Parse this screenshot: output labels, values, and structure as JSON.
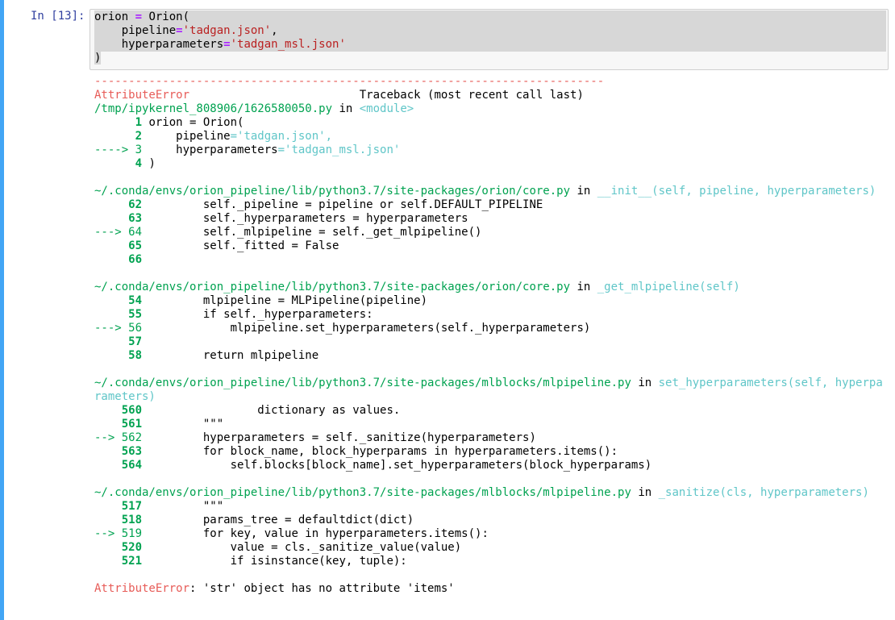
{
  "cell": {
    "prompt": "In [13]:",
    "code": {
      "l1_a": "orion ",
      "l1_eq": "=",
      "l1_b": " Orion(",
      "l2_a": "    pipeline",
      "l2_eq": "=",
      "l2_str": "'tadgan.json'",
      "l2_b": ",",
      "l3_a": "    hyperparameters",
      "l3_eq": "=",
      "l3_str": "'tadgan_msl.json'",
      "l4": ")"
    }
  },
  "traceback": {
    "dashes": "---------------------------------------------------------------------------",
    "error_name": "AttributeError",
    "header_right": "Traceback (most recent call last)",
    "frame0": {
      "file": "/tmp/ipykernel_808906/1626580050.py",
      "in": "in",
      "func": "<module>",
      "lines": [
        {
          "num": "      1",
          "code": " orion = Orion("
        },
        {
          "num": "      2",
          "code_a": "     pipeline",
          "code_b": "='tadgan.json',"
        },
        {
          "num": "----> 3",
          "code_a": "     hyperparameters",
          "code_b": "='tadgan_msl.json'"
        },
        {
          "num": "      4",
          "code": " )"
        }
      ]
    },
    "frame1": {
      "file": "~/.conda/envs/orion_pipeline/lib/python3.7/site-packages/orion/core.py",
      "in": "in",
      "func": "__init__(self, pipeline, hyperparameters)",
      "l62_num": "     62",
      "l62": "         self._pipeline = pipeline or self.DEFAULT_PIPELINE",
      "l63_num": "     63",
      "l63": "         self._hyperparameters = hyperparameters",
      "l64_num": "---> 64",
      "l64": "         self._mlpipeline = self._get_mlpipeline()",
      "l65_num": "     65",
      "l65": "         self._fitted = False",
      "l66_num": "     66"
    },
    "frame2": {
      "file": "~/.conda/envs/orion_pipeline/lib/python3.7/site-packages/orion/core.py",
      "in": "in",
      "func": "_get_mlpipeline(self)",
      "l54_num": "     54",
      "l54": "         mlpipeline = MLPipeline(pipeline)",
      "l55_num": "     55",
      "l55": "         if self._hyperparameters:",
      "l56_num": "---> 56",
      "l56": "             mlpipeline.set_hyperparameters(self._hyperparameters)",
      "l57_num": "     57",
      "l58_num": "     58",
      "l58": "         return mlpipeline"
    },
    "frame3": {
      "file": "~/.conda/envs/orion_pipeline/lib/python3.7/site-packages/mlblocks/mlpipeline.py",
      "in": "in",
      "func_a": "set_hyperparameters(self, hyperpa",
      "func_b": "rameters)",
      "l560_num": "    560",
      "l560": "                 dictionary as values.",
      "l561_num": "    561",
      "l561": "         \"\"\"",
      "l562_num": "--> 562",
      "l562": "         hyperparameters = self._sanitize(hyperparameters)",
      "l563_num": "    563",
      "l563": "         for block_name, block_hyperparams in hyperparameters.items():",
      "l564_num": "    564",
      "l564": "             self.blocks[block_name].set_hyperparameters(block_hyperparams)"
    },
    "frame4": {
      "file": "~/.conda/envs/orion_pipeline/lib/python3.7/site-packages/mlblocks/mlpipeline.py",
      "in": "in",
      "func": "_sanitize(cls, hyperparameters)",
      "l517_num": "    517",
      "l517": "         \"\"\"",
      "l518_num": "    518",
      "l518": "         params_tree = defaultdict(dict)",
      "l519_num": "--> 519",
      "l519": "         for key, value in hyperparameters.items():",
      "l520_num": "    520",
      "l520": "             value = cls._sanitize_value(value)",
      "l521_num": "    521",
      "l521": "             if isinstance(key, tuple):"
    },
    "final": {
      "error_name": "AttributeError",
      "message": ": 'str' object has no attribute 'items'"
    }
  }
}
